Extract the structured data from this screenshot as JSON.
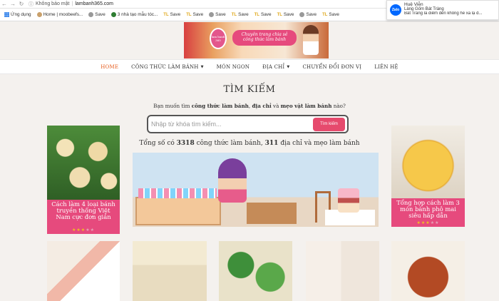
{
  "browser": {
    "not_secure_label": "Không bảo mật",
    "url": "lambanh365.com"
  },
  "bookmarks": [
    {
      "label": "Ứng dụng",
      "icon": "apps-grid-icon"
    },
    {
      "label": "Home | moobeefs...",
      "icon": "site-favicon-icon"
    },
    {
      "label": "Save",
      "icon": "globe-icon"
    },
    {
      "label": "3 nhà tạo mẫu tóc...",
      "icon": "globe-icon"
    },
    {
      "label": "Save",
      "icon": "tl-icon"
    },
    {
      "label": "Save",
      "icon": "tl-icon"
    },
    {
      "label": "Save",
      "icon": "globe-icon"
    },
    {
      "label": "Save",
      "icon": "tl-icon"
    },
    {
      "label": "Save",
      "icon": "tl-icon"
    },
    {
      "label": "Save",
      "icon": "tl-icon"
    },
    {
      "label": "Save",
      "icon": "globe-icon"
    },
    {
      "label": "Save",
      "icon": "tl-icon"
    },
    {
      "label": "Save",
      "icon": "tl-icon"
    }
  ],
  "notification": {
    "sender": "Huệ Viễn",
    "line1": "Làng Gốm Bát Tràng",
    "line2": "Bát Tràng là điểm đến không hề xa lạ đ...",
    "app": "Zalo"
  },
  "banner": {
    "slogan_line1": "Chuyên trang chia sẻ",
    "slogan_line2": "công thức làm bánh",
    "logo_text": "lam banh 365"
  },
  "menu": {
    "items": [
      {
        "label": "HOME",
        "active": true,
        "dropdown": false
      },
      {
        "label": "CÔNG THỨC LÀM BÁNH",
        "active": false,
        "dropdown": true
      },
      {
        "label": "MÓN NGON",
        "active": false,
        "dropdown": false
      },
      {
        "label": "ĐỊA CHỈ",
        "active": false,
        "dropdown": true
      },
      {
        "label": "CHUYỂN ĐỔI ĐƠN VỊ",
        "active": false,
        "dropdown": false
      },
      {
        "label": "LIÊN HỆ",
        "active": false,
        "dropdown": false
      }
    ]
  },
  "search": {
    "title": "TÌM KIẾM",
    "prompt_pre": "Bạn muốn tìm ",
    "prompt_b1": "công thức làm bánh",
    "prompt_sep1": ", ",
    "prompt_b2": "địa chỉ",
    "prompt_mid": " và ",
    "prompt_b3": "mẹo vặt làm bánh",
    "prompt_post": " nào?",
    "placeholder": "Nhập từ khóa tìm kiếm...",
    "button": "Tìm kiếm"
  },
  "stats": {
    "pre": "Tổng số có ",
    "recipes": "3318",
    "mid1": " công thức làm bánh, ",
    "addresses": "311",
    "mid2": " địa chỉ và mẹo làm bánh"
  },
  "cards": {
    "left": {
      "caption": "Cách làm 4 loại bánh truyền thống Việt Nam cực đơn giản",
      "stars": 3
    },
    "right": {
      "caption": "Tổng hợp cách làm 3 món bánh phô mai siêu hấp dẫn",
      "stars": 3
    }
  },
  "colors": {
    "accent_pink": "#e64a7d",
    "menu_active": "#e65c1c",
    "star": "#f0c020"
  }
}
